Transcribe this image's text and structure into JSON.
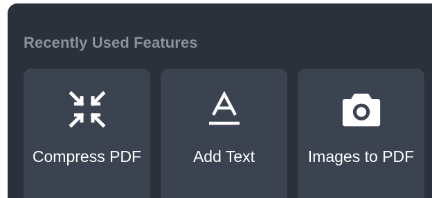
{
  "section": {
    "title": "Recently Used Features"
  },
  "features": [
    {
      "label": "Compress PDF",
      "icon": "compress-icon"
    },
    {
      "label": "Add Text",
      "icon": "text-icon"
    },
    {
      "label": "Images to PDF",
      "icon": "camera-icon"
    }
  ],
  "colors": {
    "panel_background": "#2b303a",
    "card_background": "#3c4350",
    "title_text": "#8b909b",
    "card_text": "#ffffff"
  }
}
